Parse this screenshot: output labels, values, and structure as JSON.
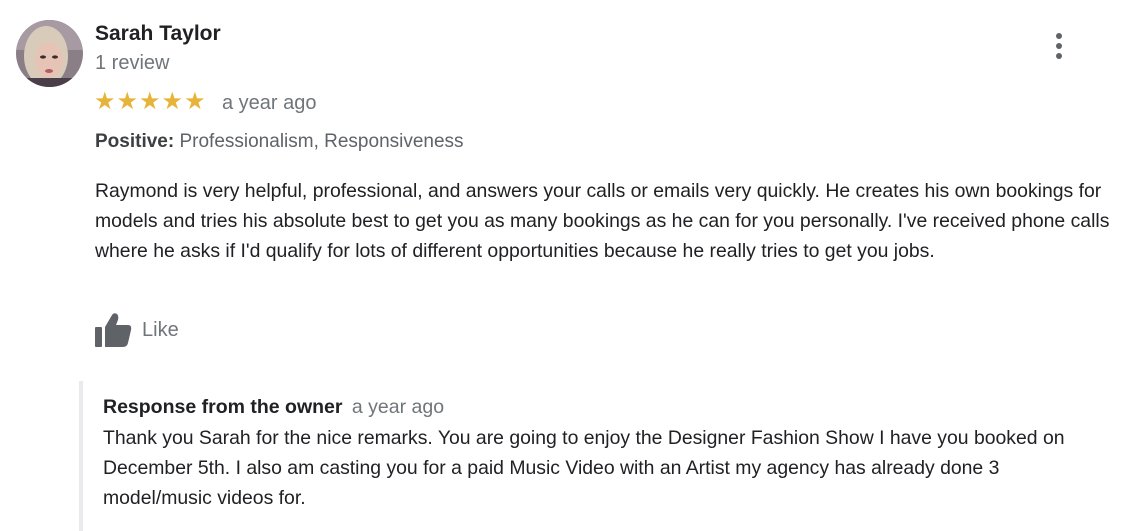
{
  "reviewer": {
    "name": "Sarah Taylor",
    "review_count": "1 review"
  },
  "rating": {
    "stars": 5,
    "max_stars": 5,
    "star_color": "#e7b43a",
    "time": "a year ago"
  },
  "positive": {
    "label": "Positive:",
    "value": "Professionalism, Responsiveness"
  },
  "review_text": "Raymond is very helpful, professional, and answers your calls or emails very quickly.  He creates his own bookings for models and tries his absolute best to get you as many bookings as he can for you personally. I've received phone calls where he asks if I'd qualify for lots of different opportunities because he really tries to get you jobs.",
  "like": {
    "label": "Like",
    "icon": "thumbs-up-icon"
  },
  "menu": {
    "icon": "more-vert-icon"
  },
  "owner_response": {
    "title": "Response from the owner",
    "time": "a year ago",
    "text": "Thank you Sarah for the nice remarks. You are going to enjoy the Designer Fashion Show I have you booked on December 5th. I also am casting you for a paid Music Video with an Artist my agency has already done 3 model/music videos for."
  }
}
